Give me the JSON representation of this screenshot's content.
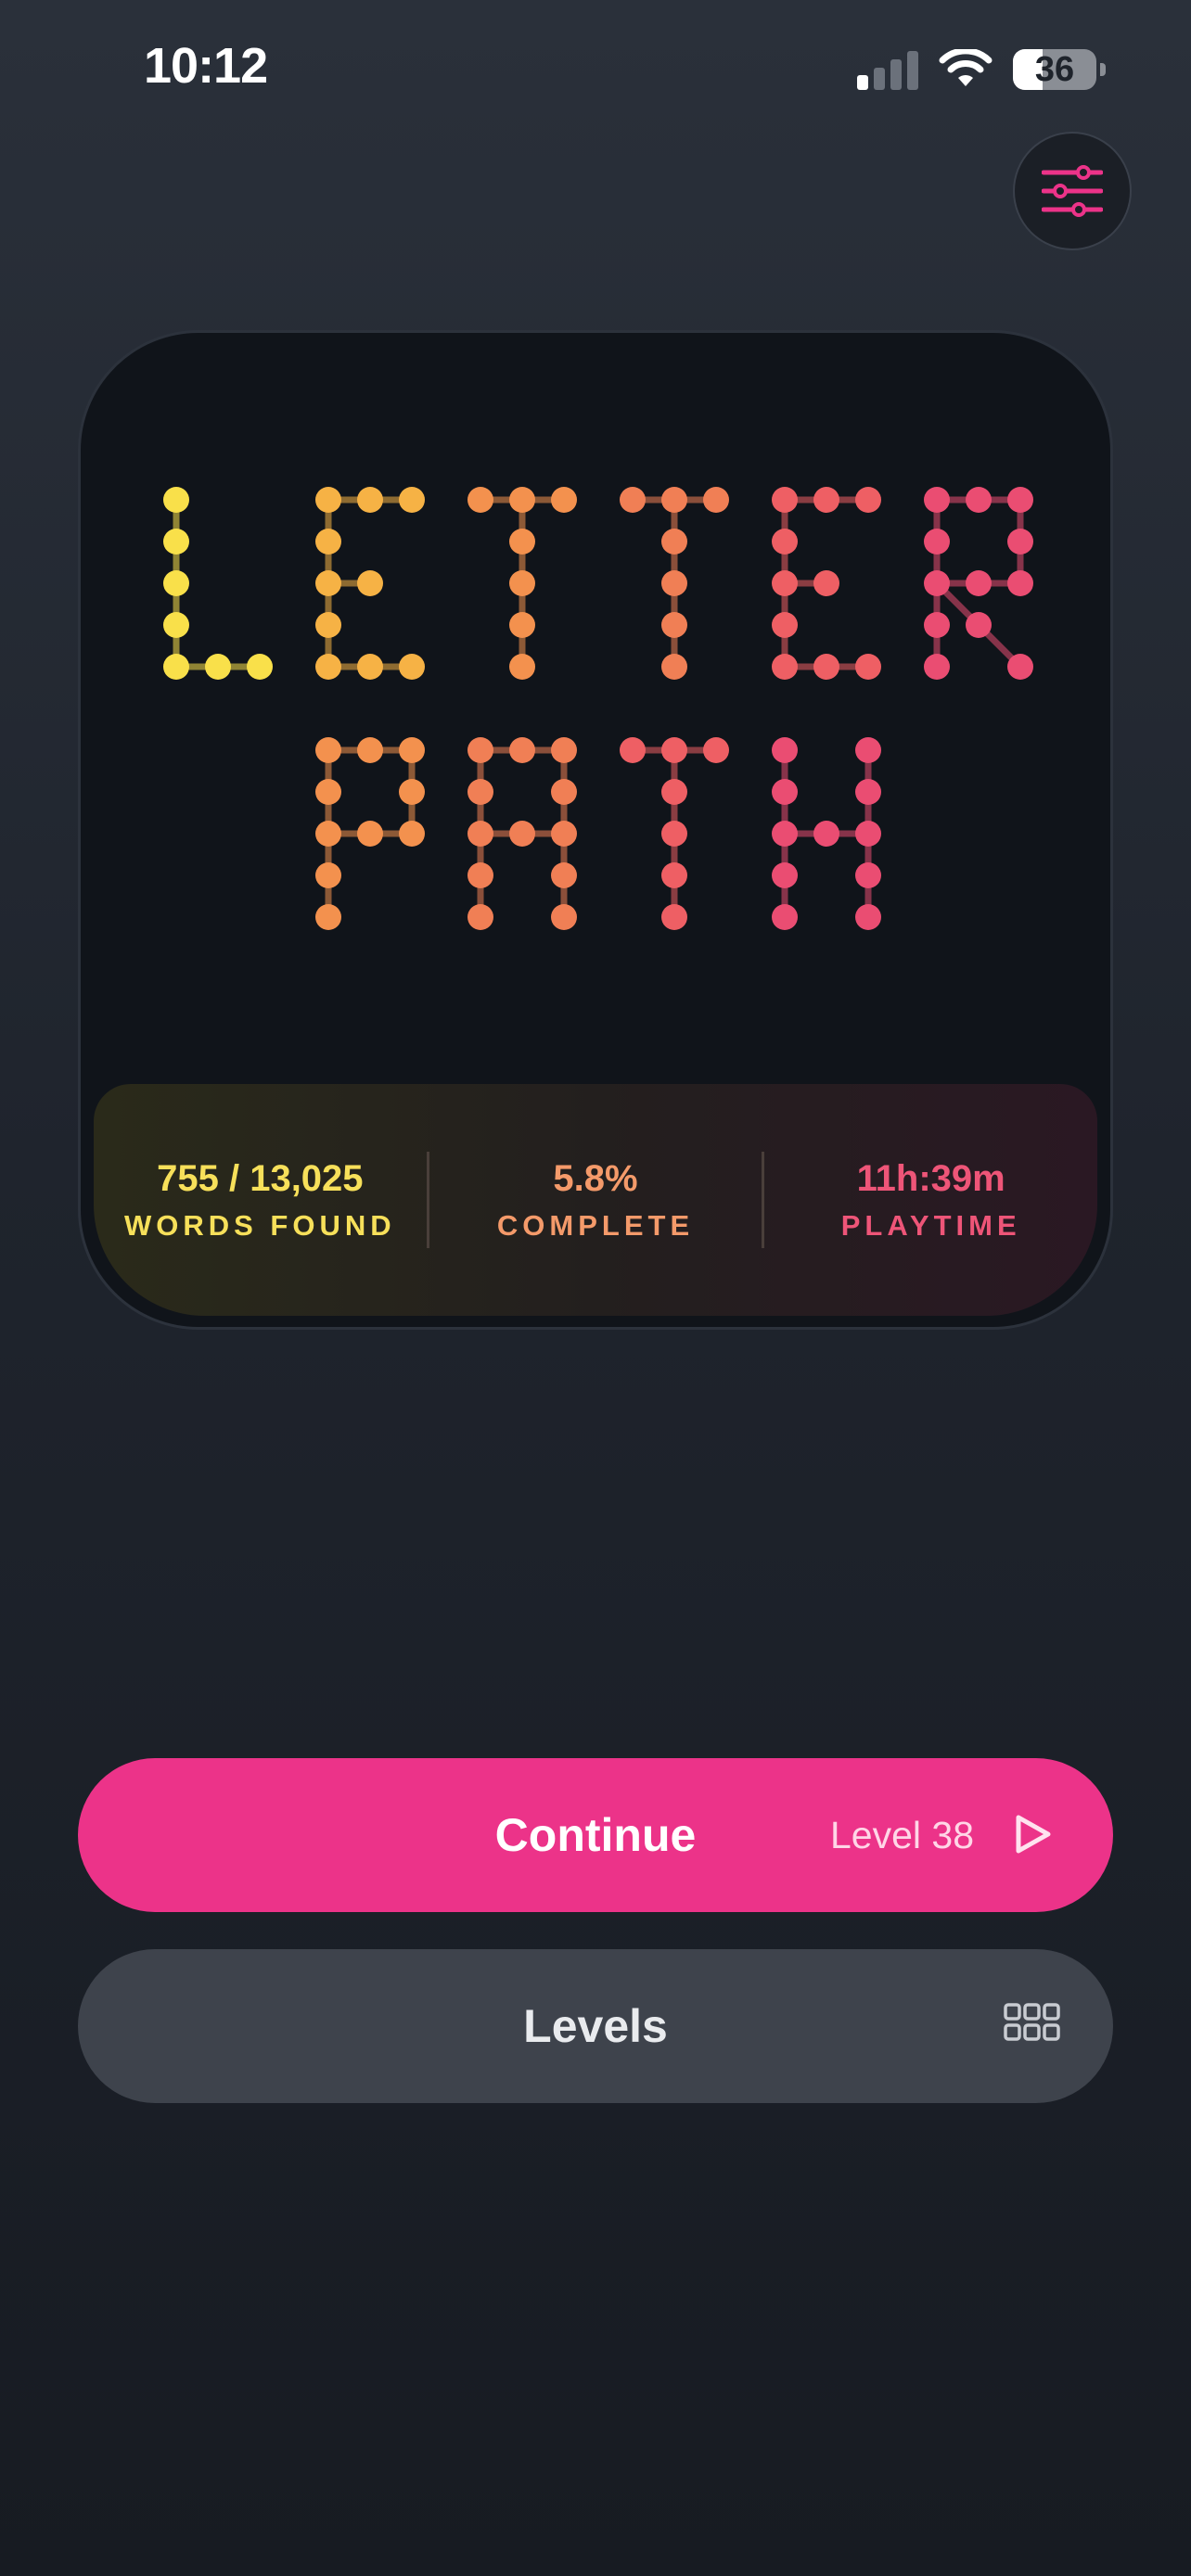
{
  "status_bar": {
    "time": "10:12",
    "battery": "36",
    "battery_level": 0.36
  },
  "logo": {
    "words": [
      "LETTER",
      "PATH"
    ],
    "colors": [
      "#f9e04a",
      "#f6b245",
      "#f3914e",
      "#f07f55",
      "#ee5f64",
      "#ea4d72",
      "#e84079"
    ]
  },
  "stats": {
    "words_found": {
      "value": "755 / 13,025",
      "label": "WORDS FOUND",
      "color": "#f7e05a"
    },
    "complete": {
      "value": "5.8%",
      "label": "COMPLETE",
      "color": "#f49a6a"
    },
    "playtime": {
      "value": "11h:39m",
      "label": "PLAYTIME",
      "color": "#ee5578"
    }
  },
  "buttons": {
    "continue": {
      "label": "Continue",
      "level": "Level 38"
    },
    "levels": {
      "label": "Levels"
    }
  },
  "icons": {
    "settings": "sliders-icon",
    "play": "play-icon",
    "grid": "grid-icon",
    "accent": "#ec3389"
  }
}
